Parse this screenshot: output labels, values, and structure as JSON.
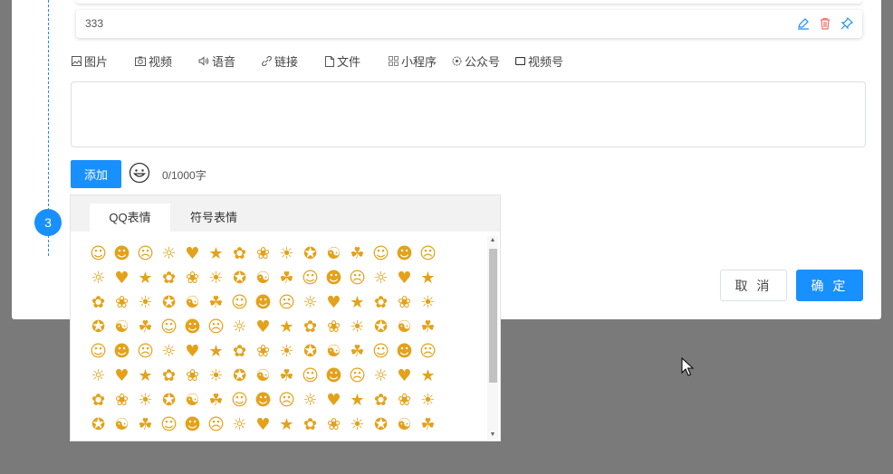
{
  "reply_card": {
    "text": "333"
  },
  "toolbar": {
    "items": [
      {
        "label": "图片",
        "icon": "image-icon"
      },
      {
        "label": "视频",
        "icon": "camera-icon"
      },
      {
        "label": "语音",
        "icon": "speaker-icon"
      },
      {
        "label": "链接",
        "icon": "link-icon"
      },
      {
        "label": "文件",
        "icon": "file-icon"
      },
      {
        "label": "小程序",
        "icon": "grid-icon"
      },
      {
        "label": "公众号",
        "icon": "official-account-icon"
      },
      {
        "label": "视频号",
        "icon": "channel-icon"
      }
    ]
  },
  "compose": {
    "add_label": "添加",
    "counter": "0/1000字"
  },
  "step": {
    "number": "3"
  },
  "dialog": {
    "cancel_label": "取 消",
    "ok_label": "确 定"
  },
  "emoji_panel": {
    "tabs": [
      "QQ表情",
      "符号表情"
    ],
    "active_tab": 0
  },
  "colors": {
    "primary": "#1890ff",
    "edit_icon": "#1890ff",
    "delete_icon": "#f56c6c",
    "overlay": "#7a7a7a"
  }
}
